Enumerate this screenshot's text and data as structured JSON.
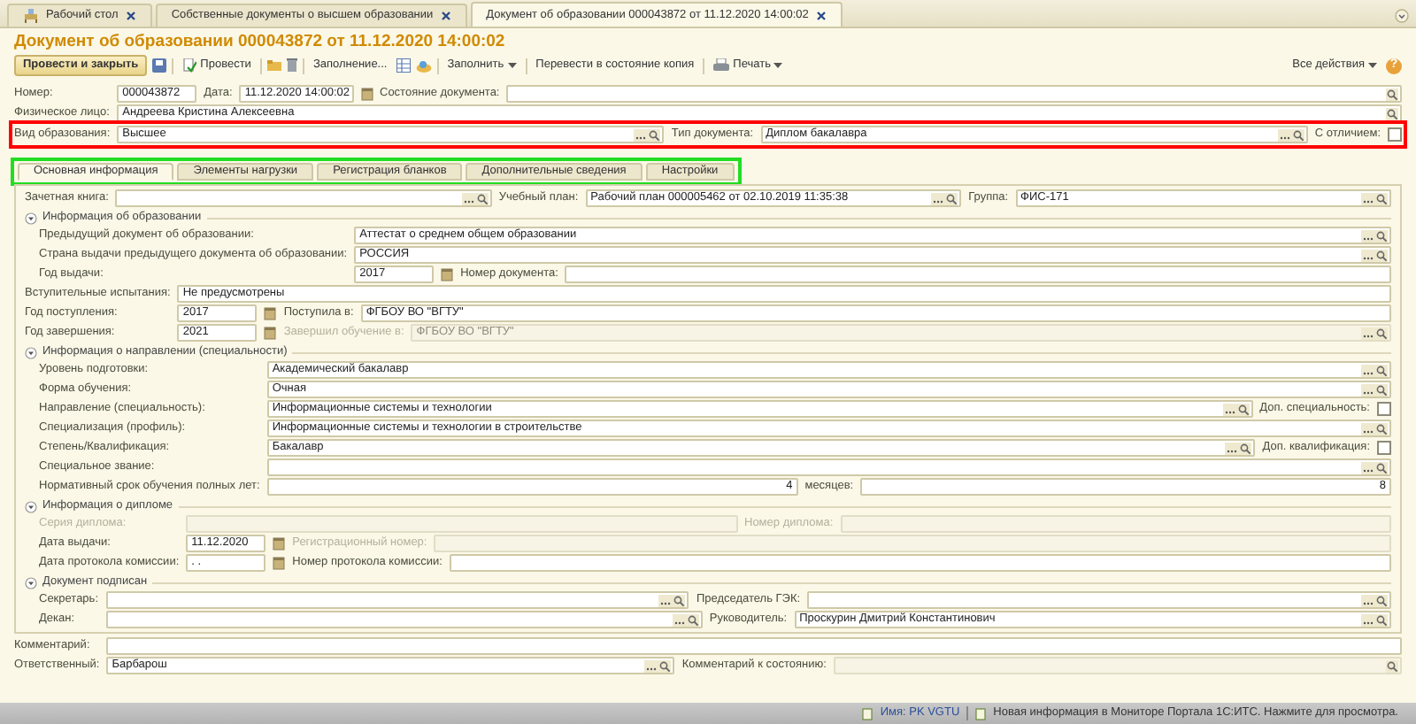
{
  "window_tabs": [
    {
      "label": "Рабочий стол",
      "selected": false
    },
    {
      "label": "Собственные документы о высшем образовании",
      "selected": false
    },
    {
      "label": "Документ об образовании 000043872 от 11.12.2020 14:00:02",
      "selected": true
    }
  ],
  "title": "Документ об образовании 000043872 от 11.12.2020 14:00:02",
  "toolbar": {
    "post_close": "Провести и закрыть",
    "post": "Провести",
    "fill_in": "Заполнение...",
    "fill": "Заполнить",
    "copy_state": "Перевести в состояние копия",
    "print": "Печать",
    "all_actions": "Все действия",
    "help": "?"
  },
  "header_rows": [
    {
      "items": [
        {
          "kind": "label",
          "text": "Номер:",
          "disabled": false
        },
        {
          "kind": "code",
          "value": "000043872",
          "disabled": false
        },
        {
          "kind": "label",
          "text": "Дата:",
          "disabled": false
        },
        {
          "kind": "date",
          "value": "11.12.2020 14:00:02",
          "disabled": false
        },
        {
          "kind": "label",
          "text": "Состояние документа:",
          "disabled": false
        },
        {
          "kind": "lookup",
          "disabled": false
        }
      ]
    },
    {
      "items": [
        {
          "kind": "label",
          "text": "Физическое лицо:",
          "disabled": false
        },
        {
          "kind": "lookup",
          "value": "Андреева Кристина Алексеевна",
          "disabled": false
        }
      ]
    },
    {
      "highlight": {
        "color": "#ff0000"
      },
      "items": [
        {
          "kind": "label",
          "text": "Вид образования:",
          "disabled": false
        },
        {
          "kind": "select",
          "value": "Высшее",
          "disabled": false
        },
        {
          "kind": "label",
          "text": "Тип документа:",
          "disabled": false
        },
        {
          "kind": "select",
          "value": "Диплом бакалавра",
          "disabled": false
        },
        {
          "kind": "label",
          "text": "С отличием:",
          "disabled": false
        },
        {
          "kind": "checkbox",
          "checked": false
        }
      ]
    }
  ],
  "form_tabs": {
    "highlight": {
      "color": "#22dd22"
    },
    "tabs": [
      {
        "label": "Основная информация",
        "selected": true
      },
      {
        "label": "Элементы нагрузки",
        "selected": false
      },
      {
        "label": "Регистрация бланков",
        "selected": false
      },
      {
        "label": "Дополнительные сведения",
        "selected": false
      },
      {
        "label": "Настройки",
        "selected": false
      }
    ]
  },
  "panel": [
    {
      "kind": "rows",
      "rows": [
        {
          "items": [
            {
              "kind": "label",
              "text": "Зачетная книга:",
              "disabled": false
            },
            {
              "kind": "select",
              "disabled": false
            },
            {
              "kind": "label",
              "text": "Учебный план:",
              "disabled": false
            },
            {
              "kind": "select",
              "value": "Рабочий план 000005462 от 02.10.2019 11:35:38",
              "disabled": false
            },
            {
              "kind": "label",
              "text": "Группа:",
              "disabled": false
            },
            {
              "kind": "select",
              "value": "ФИС-171",
              "disabled": false
            }
          ]
        }
      ]
    },
    {
      "kind": "group",
      "title": "Информация об образовании",
      "expanded": true,
      "rows": [
        {
          "items": [
            {
              "kind": "label",
              "text": "Предыдущий документ об образовании:",
              "disabled": false
            },
            {
              "kind": "select",
              "value": "Аттестат о среднем общем образовании",
              "disabled": false
            }
          ]
        },
        {
          "items": [
            {
              "kind": "label",
              "text": "Страна выдачи предыдущего документа об образовании:",
              "disabled": false
            },
            {
              "kind": "select",
              "value": "РОССИЯ",
              "disabled": false
            }
          ]
        },
        {
          "items": [
            {
              "kind": "label",
              "text": "Год выдачи:",
              "disabled": false
            },
            {
              "kind": "date",
              "value": "2017",
              "disabled": false
            },
            {
              "kind": "label",
              "text": "Номер документа:",
              "disabled": false
            },
            {
              "kind": "text",
              "disabled": false
            }
          ]
        }
      ]
    },
    {
      "kind": "rows",
      "rows": [
        {
          "items": [
            {
              "kind": "label",
              "text": "Вступительные испытания:",
              "disabled": false
            },
            {
              "kind": "text",
              "value": "Не предусмотрены",
              "disabled": false
            }
          ]
        },
        {
          "items": [
            {
              "kind": "label",
              "text": "Год поступления:",
              "disabled": false
            },
            {
              "kind": "date",
              "value": "2017",
              "disabled": false
            },
            {
              "kind": "label",
              "text": "Поступила в:",
              "disabled": false
            },
            {
              "kind": "text",
              "value": "ФГБОУ ВО \"ВГТУ\"",
              "disabled": false
            }
          ]
        },
        {
          "items": [
            {
              "kind": "label",
              "text": "Год завершения:",
              "disabled": false
            },
            {
              "kind": "date",
              "value": "2021",
              "disabled": false
            },
            {
              "kind": "label",
              "text": "Завершил обучение в:",
              "disabled": true
            },
            {
              "kind": "select",
              "value": "ФГБОУ ВО \"ВГТУ\"",
              "disabled": true
            }
          ]
        }
      ]
    },
    {
      "kind": "group",
      "title": "Информация о направлении (специальности)",
      "expanded": true,
      "rows": [
        {
          "items": [
            {
              "kind": "label",
              "text": "Уровень подготовки:",
              "disabled": false
            },
            {
              "kind": "select",
              "value": "Академический бакалавр",
              "disabled": false
            }
          ]
        },
        {
          "items": [
            {
              "kind": "label",
              "text": "Форма обучения:",
              "disabled": false
            },
            {
              "kind": "select",
              "value": "Очная",
              "disabled": false
            }
          ]
        },
        {
          "items": [
            {
              "kind": "label",
              "text": "Направление (специальность):",
              "disabled": false
            },
            {
              "kind": "select",
              "value": "Информационные системы и технологии",
              "disabled": false
            },
            {
              "kind": "label",
              "text": "Доп. специальность:",
              "disabled": false
            },
            {
              "kind": "checkbox",
              "checked": false
            }
          ]
        },
        {
          "items": [
            {
              "kind": "label",
              "text": "Специализация (профиль):",
              "disabled": false
            },
            {
              "kind": "select",
              "value": "Информационные системы и технологии в строительстве",
              "disabled": false
            }
          ]
        },
        {
          "items": [
            {
              "kind": "label",
              "text": "Степень/Квалификация:",
              "disabled": false
            },
            {
              "kind": "select",
              "value": "Бакалавр",
              "disabled": false
            },
            {
              "kind": "label",
              "text": "Доп. квалификация:",
              "disabled": false
            },
            {
              "kind": "checkbox",
              "checked": false
            }
          ]
        },
        {
          "items": [
            {
              "kind": "label",
              "text": "Специальное звание:",
              "disabled": false
            },
            {
              "kind": "select",
              "disabled": false
            }
          ]
        },
        {
          "items": [
            {
              "kind": "label",
              "text": "Нормативный срок обучения полных лет:",
              "disabled": false
            },
            {
              "kind": "number",
              "value": "4",
              "disabled": false
            },
            {
              "kind": "label",
              "text": "месяцев:",
              "disabled": false
            },
            {
              "kind": "number",
              "value": "8",
              "disabled": false
            }
          ]
        }
      ]
    },
    {
      "kind": "group",
      "title": "Информация о дипломе",
      "expanded": true,
      "rows": [
        {
          "items": [
            {
              "kind": "label",
              "text": "Серия диплома:",
              "disabled": true
            },
            {
              "kind": "text",
              "disabled": true
            },
            {
              "kind": "label",
              "text": "Номер диплома:",
              "disabled": true
            },
            {
              "kind": "text",
              "disabled": true
            }
          ]
        },
        {
          "items": [
            {
              "kind": "label",
              "text": "Дата выдачи:",
              "disabled": false
            },
            {
              "kind": "date",
              "value": "11.12.2020",
              "disabled": false
            },
            {
              "kind": "label",
              "text": "Регистрационный номер:",
              "disabled": true
            },
            {
              "kind": "text",
              "disabled": true
            }
          ]
        },
        {
          "items": [
            {
              "kind": "label",
              "text": "Дата протокола комиссии:",
              "disabled": false
            },
            {
              "kind": "date",
              "value": ". .",
              "disabled": false
            },
            {
              "kind": "label",
              "text": "Номер протокола комиссии:",
              "disabled": false
            },
            {
              "kind": "text",
              "disabled": false
            }
          ]
        }
      ]
    },
    {
      "kind": "group",
      "title": "Документ подписан",
      "expanded": true,
      "rows": [
        {
          "items": [
            {
              "kind": "label",
              "text": "Секретарь:",
              "disabled": false
            },
            {
              "kind": "select",
              "disabled": false
            },
            {
              "kind": "label",
              "text": "Председатель ГЭК:",
              "disabled": false
            },
            {
              "kind": "select",
              "disabled": false
            }
          ]
        },
        {
          "items": [
            {
              "kind": "label",
              "text": "Декан:",
              "disabled": false
            },
            {
              "kind": "select",
              "disabled": false
            },
            {
              "kind": "label",
              "text": "Руководитель:",
              "disabled": false
            },
            {
              "kind": "select",
              "value": "Проскурин Дмитрий Константинович",
              "disabled": false
            }
          ]
        }
      ]
    }
  ],
  "footer_rows": [
    {
      "items": [
        {
          "kind": "label",
          "text": "Комментарий:",
          "disabled": false
        },
        {
          "kind": "text",
          "disabled": false
        }
      ]
    },
    {
      "items": [
        {
          "kind": "label",
          "text": "Ответственный:",
          "disabled": false
        },
        {
          "kind": "select",
          "value": "Барбарош",
          "disabled": false
        },
        {
          "kind": "label",
          "text": "Комментарий к состоянию:",
          "disabled": false
        },
        {
          "kind": "lookup",
          "disabled": true
        }
      ]
    }
  ],
  "status_bar": {
    "user": "Имя: PK VGTU",
    "message": "Новая информация в Мониторе Портала 1С:ИТС. Нажмите для просмотра."
  }
}
